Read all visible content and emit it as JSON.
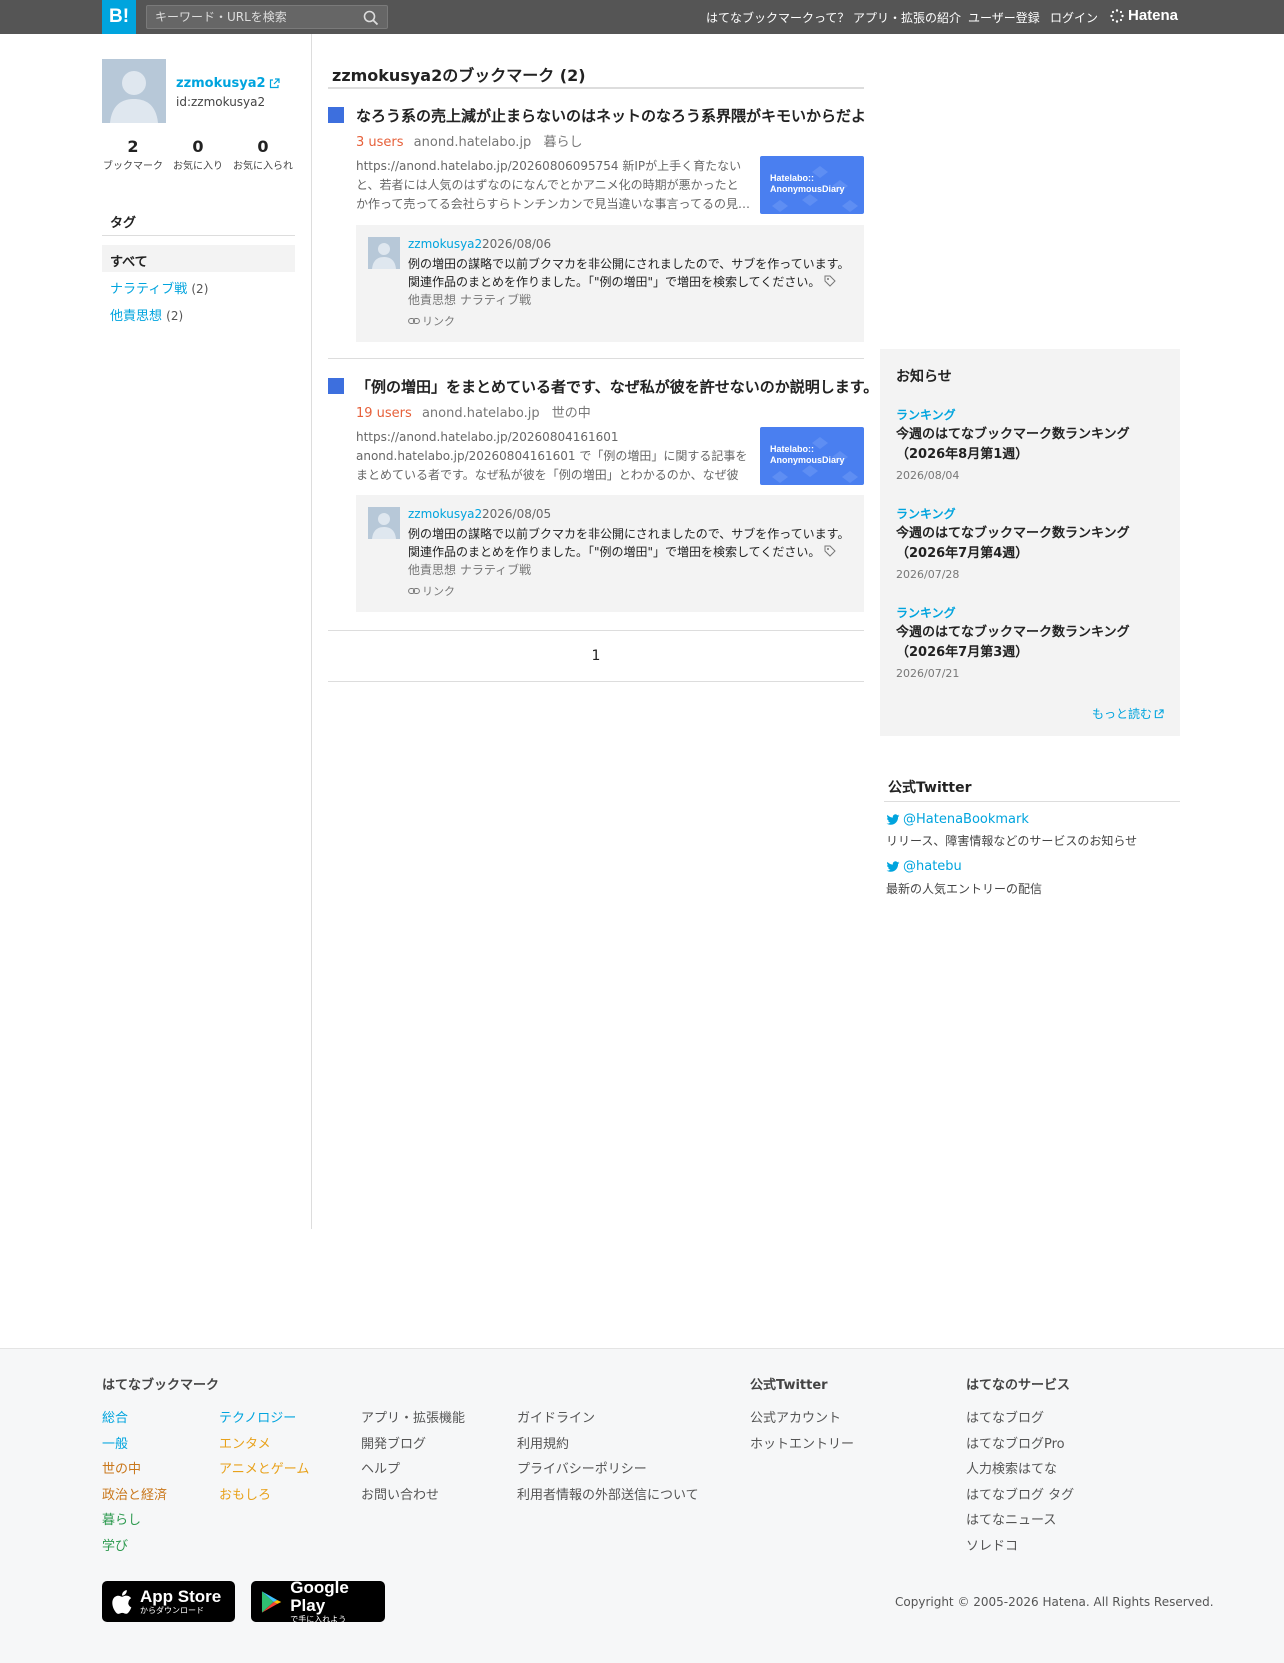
{
  "header": {
    "logo_label": "B!",
    "search_placeholder": "キーワード・URLを検索",
    "nav": [
      "はてなブックマークって？",
      "アプリ・拡張の紹介",
      "ユーザー登録",
      "ログイン"
    ],
    "hatena_logo": "Hatena"
  },
  "profile": {
    "name": "zzmokusya2",
    "id": "id:zzmokusya2",
    "stats": [
      {
        "value": "2",
        "label": "ブックマーク"
      },
      {
        "value": "0",
        "label": "お気に入り"
      },
      {
        "value": "0",
        "label": "お気に入られ"
      }
    ]
  },
  "tags": {
    "title": "タグ",
    "all": "すべて",
    "items": [
      {
        "name": "ナラティブ戦",
        "count": "(2)"
      },
      {
        "name": "他責思想",
        "count": "(2)"
      }
    ]
  },
  "main": {
    "title": "zzmokusya2のブックマーク (2)",
    "entries": [
      {
        "title": "なろう系の売上減が止まらないのはネットのなろう系界隈がキモいからだよ",
        "users": "3 users",
        "domain": "anond.hatelabo.jp",
        "category": "暮らし",
        "description": "https://anond.hatelabo.jp/20260806095754 新IPが上手く育たないと、若者には人気のはずなのになんでとかアニメ化の時期が悪かったとか作って売ってる会社らすらトンチンカンで見当違いな事言ってるの見…",
        "thumb_text": "Hatelabo::\nAnonymousDiary",
        "comment": {
          "user": "zzmokusya2",
          "date": "2026/08/06",
          "text": "例の増田の謀略で以前ブクマカを非公開にされましたので、サブを作っています。関連作品のまとめを作りました。「\"例の増田\"」で増田を検索してください。",
          "tags": "他責思想  ナラティブ戦",
          "link": "リンク"
        }
      },
      {
        "title": "「例の増田」をまとめている者です、なぜ私が彼を許せないのか説明します。",
        "users": "19 users",
        "domain": "anond.hatelabo.jp",
        "category": "世の中",
        "description": "https://anond.hatelabo.jp/20260804161601 anond.hatelabo.jp/20260804161601 で「例の増田」に関する記事をまとめている者です。なぜ私が彼を「例の増田」とわかるのか、なぜ彼のサイバー・ナラティブ戦争…",
        "thumb_text": "Hatelabo::\nAnonymousDiary",
        "comment": {
          "user": "zzmokusya2",
          "date": "2026/08/05",
          "text": "例の増田の謀略で以前ブクマカを非公開にされましたので、サブを作っています。関連作品のまとめを作りました。「\"例の増田\"」で増田を検索してください。",
          "tags": "他責思想  ナラティブ戦",
          "link": "リンク"
        }
      }
    ],
    "page": "1"
  },
  "notices": {
    "title": "お知らせ",
    "items": [
      {
        "category": "ランキング",
        "title": "今週のはてなブックマーク数ランキング（2026年8月第1週）",
        "date": "2026/08/04"
      },
      {
        "category": "ランキング",
        "title": "今週のはてなブックマーク数ランキング（2026年7月第4週）",
        "date": "2026/07/28"
      },
      {
        "category": "ランキング",
        "title": "今週のはてなブックマーク数ランキング（2026年7月第3週）",
        "date": "2026/07/21"
      }
    ],
    "more": "もっと読む"
  },
  "twitter": {
    "title": "公式Twitter",
    "accounts": [
      {
        "handle": "@HatenaBookmark",
        "desc": "リリース、障害情報などのサービスのお知らせ"
      },
      {
        "handle": "@hatebu",
        "desc": "最新の人気エントリーの配信"
      }
    ]
  },
  "footer": {
    "col1_title": "はてなブックマーク",
    "categories_a": [
      {
        "label": "総合",
        "color": "#00a4de"
      },
      {
        "label": "一般",
        "color": "#00a4de"
      },
      {
        "label": "世の中",
        "color": "#c9771b"
      },
      {
        "label": "政治と経済",
        "color": "#c9771b"
      },
      {
        "label": "暮らし",
        "color": "#2d9a4f"
      },
      {
        "label": "学び",
        "color": "#2d9a4f"
      }
    ],
    "categories_b": [
      {
        "label": "テクノロジー",
        "color": "#00a4de"
      },
      {
        "label": "エンタメ",
        "color": "#e8a21c"
      },
      {
        "label": "アニメとゲーム",
        "color": "#e8a21c"
      },
      {
        "label": "おもしろ",
        "color": "#e8a21c"
      }
    ],
    "links_c": [
      "アプリ・拡張機能",
      "開発ブログ",
      "ヘルプ",
      "お問い合わせ"
    ],
    "links_d": [
      "ガイドライン",
      "利用規約",
      "プライバシーポリシー",
      "利用者情報の外部送信について"
    ],
    "twitter_title": "公式Twitter",
    "twitter_links": [
      "公式アカウント",
      "ホットエントリー"
    ],
    "services_title": "はてなのサービス",
    "services": [
      "はてなブログ",
      "はてなブログPro",
      "人力検索はてな",
      "はてなブログ タグ",
      "はてなニュース",
      "ソレドコ"
    ],
    "app_store": {
      "big": "App Store",
      "small": "からダウンロード"
    },
    "google_play": {
      "big": "Google Play",
      "small": "で手に入れよう"
    },
    "copyright": "Copyright © 2005-2026 Hatena. All Rights Reserved."
  }
}
